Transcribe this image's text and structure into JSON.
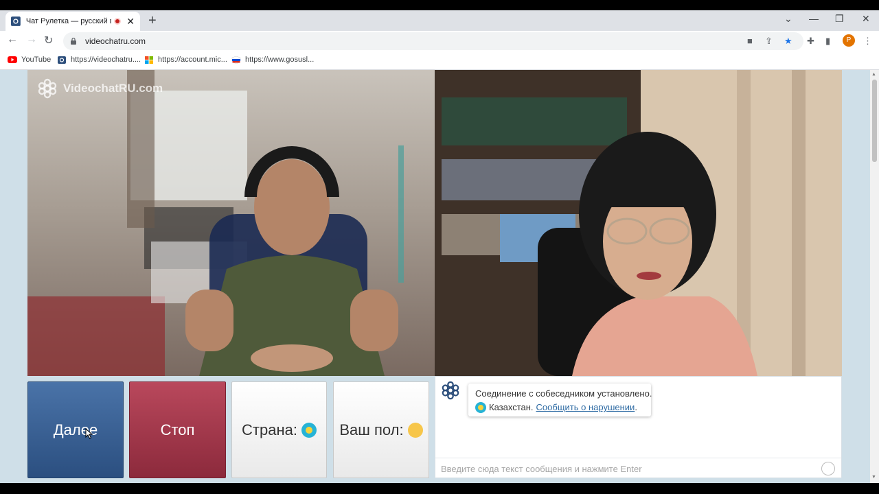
{
  "browser": {
    "tab_title": "Чат Рулетка — русский вид",
    "tab_close": "✕",
    "new_tab": "+",
    "url": "videochatru.com",
    "minimize": "—",
    "restore": "❐",
    "close": "✕",
    "tab_list": "⌄",
    "profile_initial": "P",
    "bookmarks": [
      {
        "label": "YouTube",
        "icon": "youtube-icon"
      },
      {
        "label": "https://videochatru....",
        "icon": "videochat-icon"
      },
      {
        "label": "https://account.mic...",
        "icon": "microsoft-icon"
      },
      {
        "label": "https://www.gosusl...",
        "icon": "gosuslugi-icon"
      }
    ]
  },
  "page": {
    "watermark": "VideochatRU.com",
    "buttons": {
      "next": "Далее",
      "stop": "Стоп",
      "country": "Страна:",
      "gender": "Ваш пол:"
    },
    "chat": {
      "message_line1": "Соединение с собеседником установлено.",
      "country": "Казахстан.",
      "report_link": "Сообщить о нарушении",
      "period": ".",
      "input_placeholder": "Введите сюда текст сообщения и нажмите Enter"
    }
  },
  "colors": {
    "next_button": "#2b4f80",
    "stop_button": "#8c2a3c",
    "page_bg": "#cfdfe8",
    "link": "#2d6aa3"
  }
}
